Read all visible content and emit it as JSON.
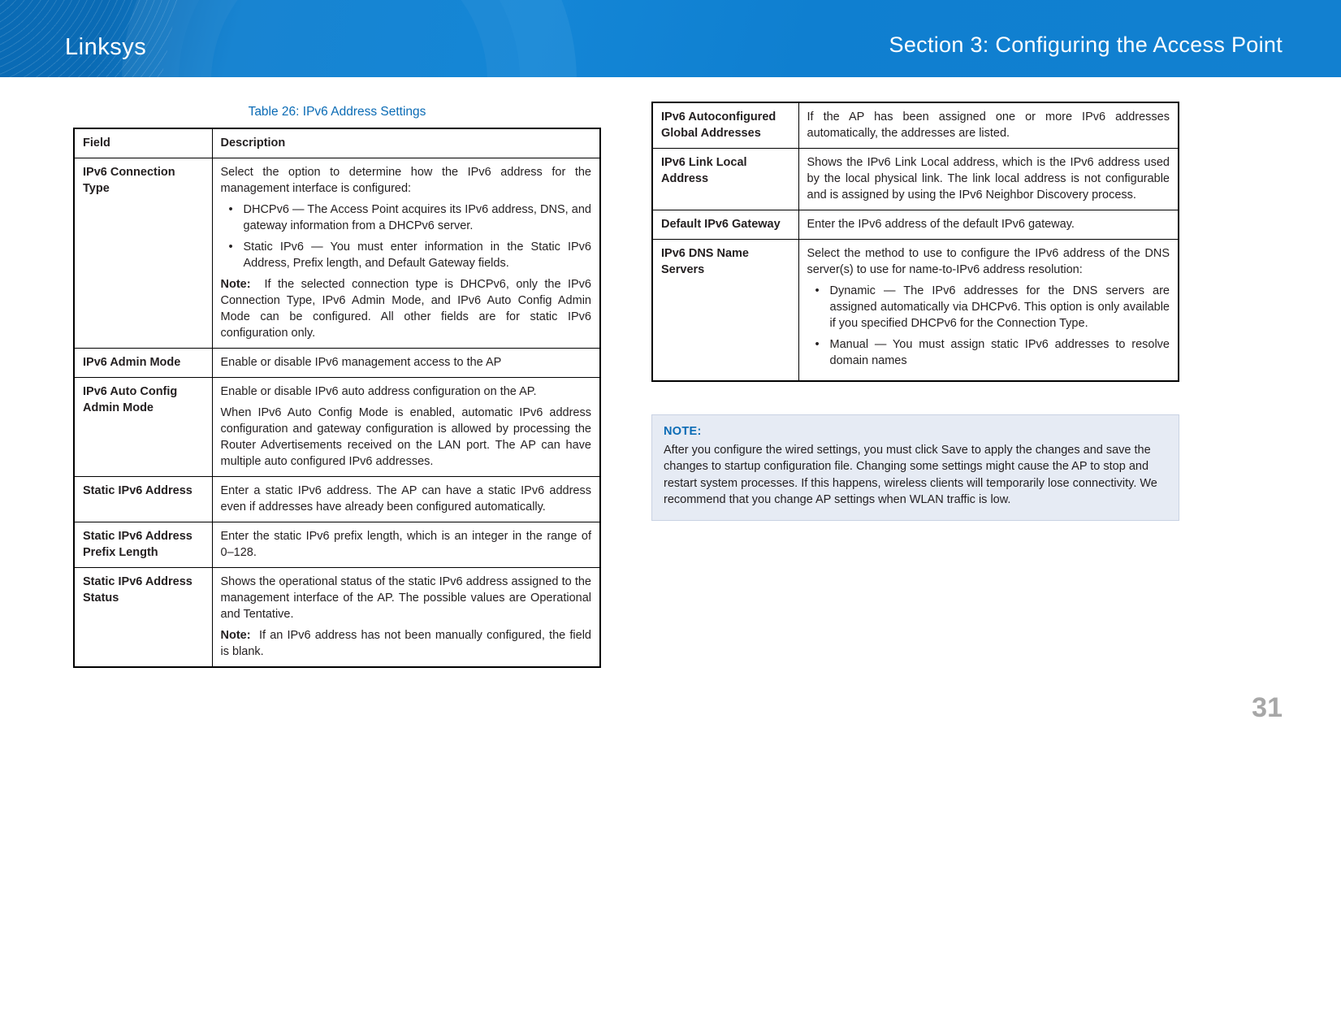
{
  "header": {
    "brand": "Linksys",
    "section": "Section 3:  Configuring the Access Point"
  },
  "table_caption": "Table 26: IPv6 Address Settings",
  "columns": {
    "field": "Field",
    "desc": "Description"
  },
  "left_rows": [
    {
      "field": "IPv6 Connection Type",
      "desc_intro": "Select the option to determine how the IPv6 address for the management interface is configured:",
      "bullets": [
        "DHCPv6 — The Access Point acquires its IPv6 address, DNS, and gateway information from a DHCPv6 server.",
        "Static IPv6 — You must enter information in the Static IPv6 Address, Prefix length, and Default Gateway fields."
      ],
      "note_label": "Note:",
      "note": "If the selected connection type is DHCPv6, only the IPv6 Connection Type, IPv6 Admin Mode, and IPv6 Auto Config Admin Mode can be configured. All other fields are for static IPv6 configuration only."
    },
    {
      "field": "IPv6 Admin Mode",
      "desc_intro": "Enable or disable IPv6 management access to the AP"
    },
    {
      "field": "IPv6 Auto Config Admin Mode",
      "desc_intro": "Enable or disable IPv6 auto address configuration on the AP.",
      "para2": "When IPv6 Auto Config Mode is enabled, automatic IPv6 address configuration and gateway configuration is allowed by processing the Router Advertisements received on the LAN port. The AP can have multiple auto configured IPv6 addresses."
    },
    {
      "field": "Static IPv6 Address",
      "desc_intro": "Enter a static IPv6 address. The AP can have a static IPv6 address even if addresses have already been configured automatically."
    },
    {
      "field": "Static IPv6 Address Prefix Length",
      "desc_intro": "Enter the static IPv6 prefix length, which is an integer in the range of 0–128."
    },
    {
      "field": "Static IPv6 Address Status",
      "desc_intro": "Shows the operational status of the static IPv6 address assigned to the management interface of the AP. The possible values are Operational and Tentative.",
      "note_label": "Note:",
      "note": "If an IPv6 address has not been manually configured, the field is blank."
    }
  ],
  "right_rows": [
    {
      "field": "IPv6 Autoconfigured Global Addresses",
      "desc_intro": "If the AP has been assigned one or more IPv6 addresses automatically, the addresses are listed."
    },
    {
      "field": "IPv6 Link Local Address",
      "desc_intro": "Shows the IPv6 Link Local address, which is the IPv6 address used by the local physical link. The link local address is not configurable and is assigned by using the IPv6 Neighbor Discovery process."
    },
    {
      "field": "Default IPv6 Gateway",
      "desc_intro": "Enter the IPv6 address of the default IPv6 gateway."
    },
    {
      "field": "IPv6 DNS Name Servers",
      "desc_intro": "Select the method to use to configure the IPv6 address of the DNS server(s) to use for name-to-IPv6 address resolution:",
      "bullets": [
        "Dynamic  — The IPv6 addresses for the DNS servers are assigned automatically via DHCPv6. This option is only available if you specified DHCPv6 for the Connection Type.",
        "Manual — You must assign static IPv6 addresses to resolve domain names"
      ]
    }
  ],
  "note_box": {
    "head": "NOTE:",
    "body": "After you configure the wired settings, you must click Save to apply the changes and save the changes to startup configuration file. Changing some settings might cause the AP to stop and restart system processes. If this happens, wireless clients will temporarily lose connectivity. We recommend that you change AP settings when WLAN traffic is low."
  },
  "page_number": "31"
}
